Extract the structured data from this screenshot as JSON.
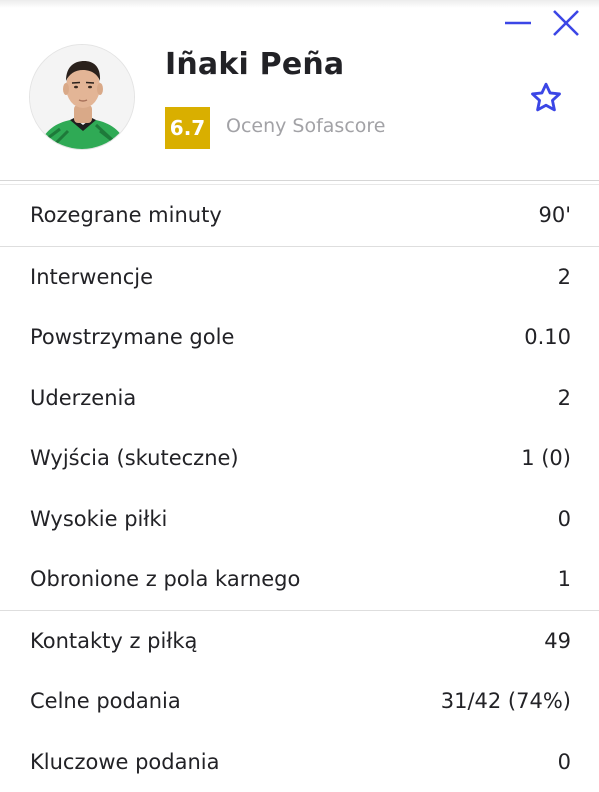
{
  "window": {
    "minimize_icon": "minus-icon",
    "close_icon": "close-icon",
    "accent_color": "#3b46e6"
  },
  "player": {
    "name": "Iñaki Peña",
    "rating": "6.7",
    "rating_label": "Oceny Sofascore",
    "rating_color": "#d9af00",
    "favorite_icon": "star-outline-icon"
  },
  "stat_groups": [
    {
      "rows": [
        {
          "label": "Rozegrane minuty",
          "value": "90'"
        }
      ]
    },
    {
      "rows": [
        {
          "label": "Interwencje",
          "value": "2"
        },
        {
          "label": "Powstrzymane gole",
          "value": "0.10"
        },
        {
          "label": "Uderzenia",
          "value": "2"
        },
        {
          "label": "Wyjścia (skuteczne)",
          "value": "1 (0)"
        },
        {
          "label": "Wysokie piłki",
          "value": "0"
        },
        {
          "label": "Obronione z pola karnego",
          "value": "1"
        }
      ]
    },
    {
      "rows": [
        {
          "label": "Kontakty z piłką",
          "value": "49"
        },
        {
          "label": "Celne podania",
          "value": "31/42 (74%)"
        },
        {
          "label": "Kluczowe podania",
          "value": "0"
        }
      ]
    }
  ]
}
